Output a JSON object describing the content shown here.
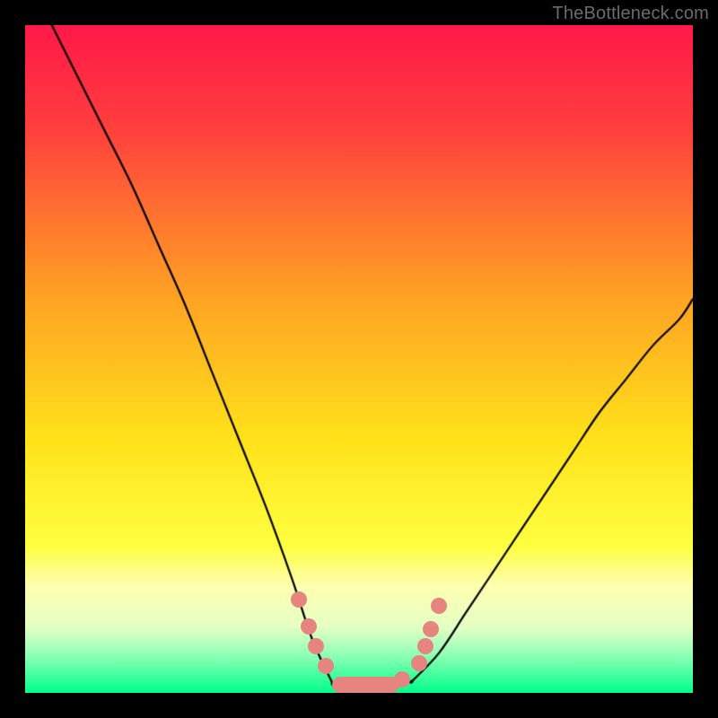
{
  "watermark": "TheBottleneck.com",
  "chart_data": {
    "type": "line",
    "title": "",
    "xlabel": "",
    "ylabel": "",
    "x_range": [
      0,
      100
    ],
    "y_range": [
      0,
      100
    ],
    "gradient": {
      "stops": [
        {
          "pct": 0,
          "color": "#ff1948"
        },
        {
          "pct": 15,
          "color": "#ff3d3e"
        },
        {
          "pct": 40,
          "color": "#ffa024"
        },
        {
          "pct": 62,
          "color": "#ffe21a"
        },
        {
          "pct": 78,
          "color": "#ffff40"
        },
        {
          "pct": 84,
          "color": "#fdffb0"
        },
        {
          "pct": 90,
          "color": "#e6ffc4"
        },
        {
          "pct": 94,
          "color": "#97ffb8"
        },
        {
          "pct": 100,
          "color": "#00ff8a"
        }
      ]
    },
    "series": [
      {
        "name": "left_branch",
        "x": [
          4,
          8,
          12,
          16,
          20,
          24,
          28,
          32,
          36,
          40,
          43,
          46
        ],
        "y": [
          100,
          92,
          84,
          76,
          67,
          58,
          48,
          38,
          28,
          17,
          8,
          1.5
        ]
      },
      {
        "name": "plateau",
        "x": [
          46,
          48,
          50,
          52,
          54,
          56,
          58
        ],
        "y": [
          1.5,
          1.2,
          1.1,
          1.0,
          1.0,
          1.2,
          1.8
        ]
      },
      {
        "name": "right_branch",
        "x": [
          58,
          62,
          66,
          70,
          74,
          78,
          82,
          86,
          90,
          94,
          98,
          100
        ],
        "y": [
          1.8,
          6,
          12,
          18,
          24,
          30,
          36,
          42,
          47,
          52,
          56,
          59
        ]
      }
    ],
    "markers": {
      "color": "#e6857f",
      "dots": [
        {
          "x": 41,
          "y": 14
        },
        {
          "x": 42.5,
          "y": 10
        },
        {
          "x": 43.5,
          "y": 7
        },
        {
          "x": 45,
          "y": 4
        },
        {
          "x": 56.5,
          "y": 2
        },
        {
          "x": 59,
          "y": 4.5
        },
        {
          "x": 60,
          "y": 7
        },
        {
          "x": 60.8,
          "y": 9.5
        },
        {
          "x": 62,
          "y": 13
        }
      ],
      "pill": {
        "x_start": 46,
        "x_end": 56,
        "y": 1.2
      }
    }
  }
}
